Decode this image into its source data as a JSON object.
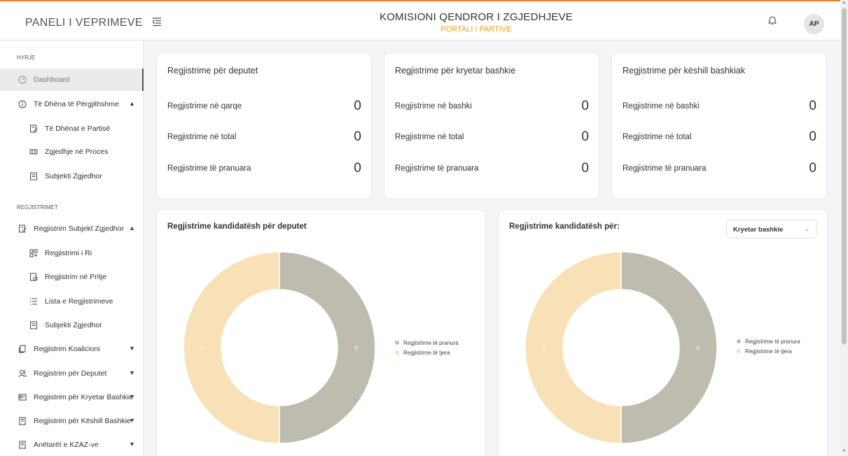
{
  "header": {
    "brand": "PANELI I VEPRIMEVE",
    "title": "KOMISIONI QENDROR I ZGJEDHJEVE",
    "subtitle": "PORTALI I PARTIVE",
    "avatar": "AP"
  },
  "sidebar": {
    "sections": [
      "HYRJE",
      "REGJISTRIMET"
    ],
    "items": [
      {
        "label": "Dashboard",
        "icon": "dashboard-gauge-icon"
      },
      {
        "label": "Të Dhëna të Përgjithshme",
        "icon": "info-circle-icon"
      },
      {
        "label": "Të Dhënat e Partisë",
        "icon": "document-edit-icon"
      },
      {
        "label": "Zgjedhje në Proces",
        "icon": "process-icon"
      },
      {
        "label": "Subjekti Zgjedhor",
        "icon": "document-list-icon"
      },
      {
        "label": "Regjistrim Subjekt Zgjedhor",
        "icon": "document-edit-icon"
      },
      {
        "label": "Regjistrimi i Ri",
        "icon": "new-grid-icon"
      },
      {
        "label": "Regjistrim në Pritje",
        "icon": "pending-document-icon"
      },
      {
        "label": "Lista e Regjistrimeve",
        "icon": "list-icon"
      },
      {
        "label": "Subjekti Zgjedhor",
        "icon": "document-list-icon"
      },
      {
        "label": "Regjistrim Koalicioni",
        "icon": "coalition-document-icon"
      },
      {
        "label": "Regjistrim për Deputet",
        "icon": "users-icon"
      },
      {
        "label": "Regjistrim për Kryetar Bashkie",
        "icon": "id-card-icon"
      },
      {
        "label": "Regjistrim për Këshill Bashkie",
        "icon": "building-icon"
      },
      {
        "label": "Anëtarët e KZAZ-ve",
        "icon": "building-icon"
      }
    ]
  },
  "cards": [
    {
      "title": "Regjistrime për deputet",
      "rows": [
        {
          "label": "Regjistrime në qarqe",
          "value": "0"
        },
        {
          "label": "Regjistrime në total",
          "value": "0"
        },
        {
          "label": "Regjistrime të pranuara",
          "value": "0"
        }
      ]
    },
    {
      "title": "Regjistrime për kryetar bashkie",
      "rows": [
        {
          "label": "Regjistrime në bashki",
          "value": "0"
        },
        {
          "label": "Regjistrime në total",
          "value": "0"
        },
        {
          "label": "Regjistrime të pranuara",
          "value": "0"
        }
      ]
    },
    {
      "title": "Regjistrime për këshill bashkiak",
      "rows": [
        {
          "label": "Regjistrime në bashki",
          "value": "0"
        },
        {
          "label": "Regjistrime në total",
          "value": "0"
        },
        {
          "label": "Regjistrime të pranuara",
          "value": "0"
        }
      ]
    }
  ],
  "charts": {
    "left": {
      "title": "Regjistrime kandidatësh për deputet"
    },
    "right": {
      "title": "Regjistrime kandidatësh për:",
      "select_value": "Kryetar bashkie"
    }
  },
  "colors": {
    "accepted": "#bdbcaf",
    "other": "#f9e1b7",
    "accent": "#e8a01a"
  },
  "chart_data": [
    {
      "type": "pie",
      "title": "Regjistrime kandidatësh për deputet",
      "categories": [
        "Regjistrime të pranura",
        "Regjistrime të tjera"
      ],
      "values": [
        0,
        0
      ],
      "data_labels": [
        "0",
        "0"
      ],
      "legend": "right"
    },
    {
      "type": "pie",
      "title": "Regjistrime kandidatësh për:",
      "categories": [
        "Regjistrime të pranura",
        "Regjistrime të tjera"
      ],
      "values": [
        0,
        0
      ],
      "data_labels": [
        "0",
        "0"
      ],
      "legend": "right"
    }
  ]
}
